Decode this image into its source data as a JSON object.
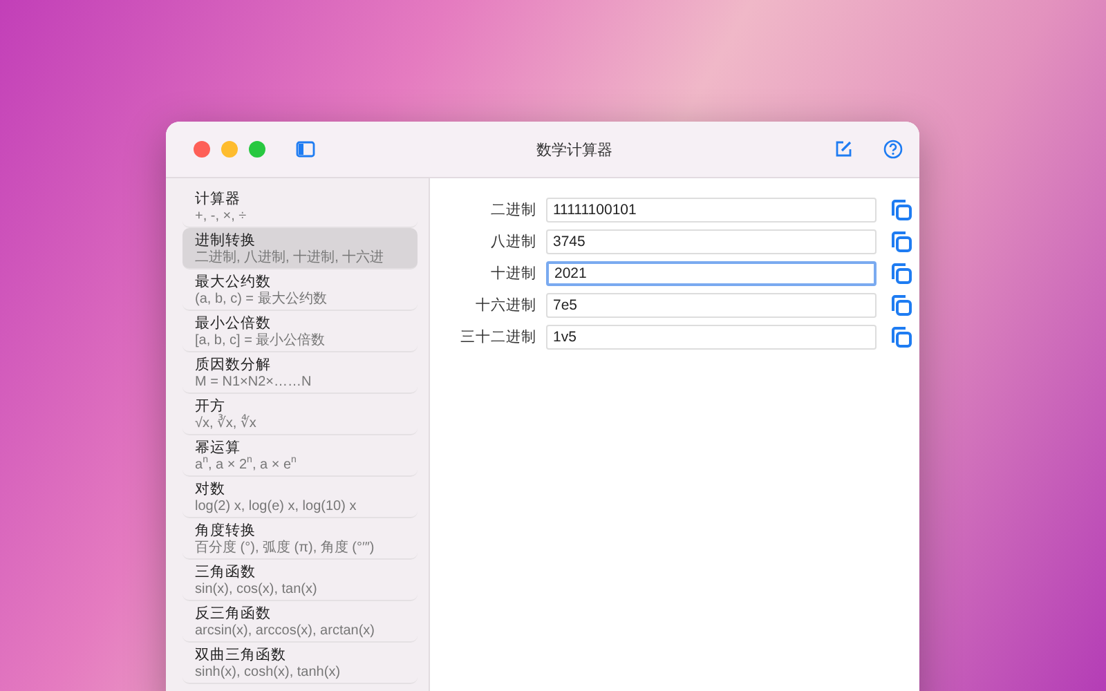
{
  "window": {
    "title": "数学计算器"
  },
  "sidebar": {
    "items": [
      {
        "title": "计算器",
        "subtitle": "+, -, ×, ÷",
        "selected": false
      },
      {
        "title": "进制转换",
        "subtitle": "二进制, 八进制, 十进制, 十六进",
        "selected": true
      },
      {
        "title": "最大公约数",
        "subtitle": "(a, b, c) = 最大公约数",
        "selected": false
      },
      {
        "title": "最小公倍数",
        "subtitle": "[a, b, c] = 最小公倍数",
        "selected": false
      },
      {
        "title": "质因数分解",
        "subtitle": "M = N1×N2×……N",
        "selected": false
      },
      {
        "title": "开方",
        "subtitle": "√x, ∛x, ∜x",
        "selected": false
      },
      {
        "title": "幂运算",
        "subtitle": "a$^{n}$, a × 2$^{n}$, a × e$^{n}$",
        "selected": false
      },
      {
        "title": "对数",
        "subtitle": "log(2) x, log(e) x, log(10) x",
        "selected": false
      },
      {
        "title": "角度转换",
        "subtitle": "百分度 (°), 弧度 (π), 角度 (°′″)",
        "selected": false
      },
      {
        "title": "三角函数",
        "subtitle": "sin(x), cos(x), tan(x)",
        "selected": false
      },
      {
        "title": "反三角函数",
        "subtitle": "arcsin(x), arccos(x), arctan(x)",
        "selected": false
      },
      {
        "title": "双曲三角函数",
        "subtitle": "sinh(x), cosh(x), tanh(x)",
        "selected": false
      }
    ]
  },
  "fields": [
    {
      "label": "二进制",
      "value": "11111100101",
      "focused": false
    },
    {
      "label": "八进制",
      "value": "3745",
      "focused": false
    },
    {
      "label": "十进制",
      "value": "2021",
      "focused": true
    },
    {
      "label": "十六进制",
      "value": "7e5",
      "focused": false
    },
    {
      "label": "三十二进制",
      "value": "1v5",
      "focused": false
    }
  ]
}
